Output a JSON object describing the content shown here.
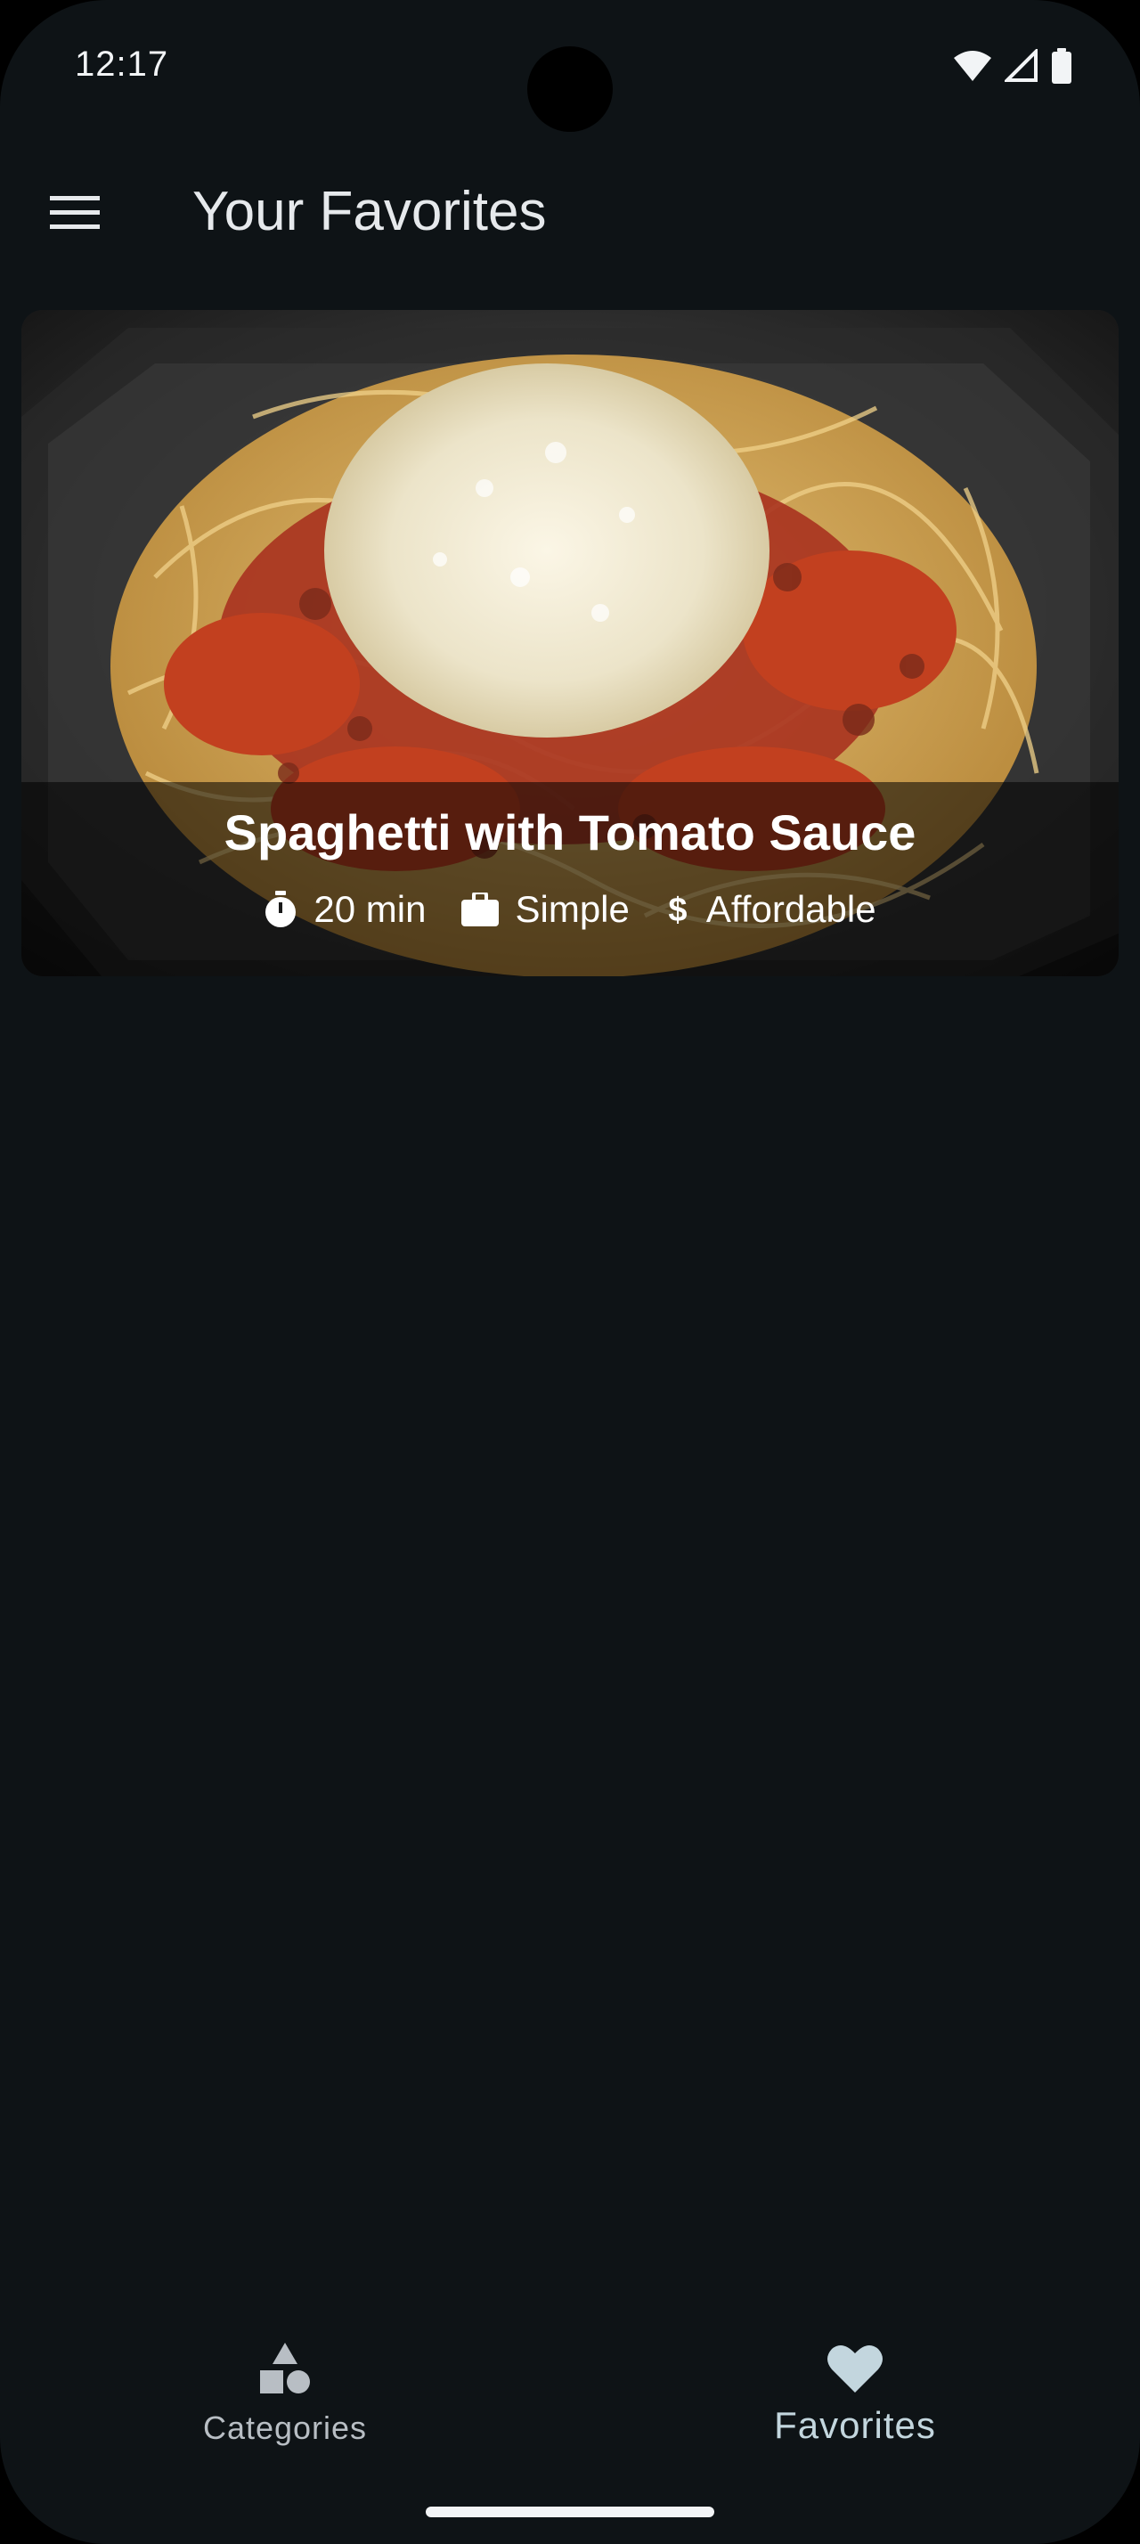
{
  "status_bar": {
    "time": "12:17",
    "icons": [
      "wifi-icon",
      "cellular-signal-icon",
      "battery-icon"
    ]
  },
  "app_bar": {
    "title": "Your Favorites",
    "menu_icon": "hamburger-menu-icon"
  },
  "favorites": [
    {
      "title": "Spaghetti with Tomato Sauce",
      "duration": "20 min",
      "complexity": "Simple",
      "affordability": "Affordable",
      "image": "spaghetti-with-tomato-sauce-and-parmesan"
    }
  ],
  "bottom_nav": {
    "items": [
      {
        "label": "Categories",
        "icon": "categories-shapes-icon",
        "selected": false
      },
      {
        "label": "Favorites",
        "icon": "heart-icon",
        "selected": true
      }
    ]
  },
  "colors": {
    "background": "#0e1316",
    "title_text": "#e6e9ec",
    "active_nav": "#c3d6de",
    "inactive_nav": "#b8bec4"
  }
}
